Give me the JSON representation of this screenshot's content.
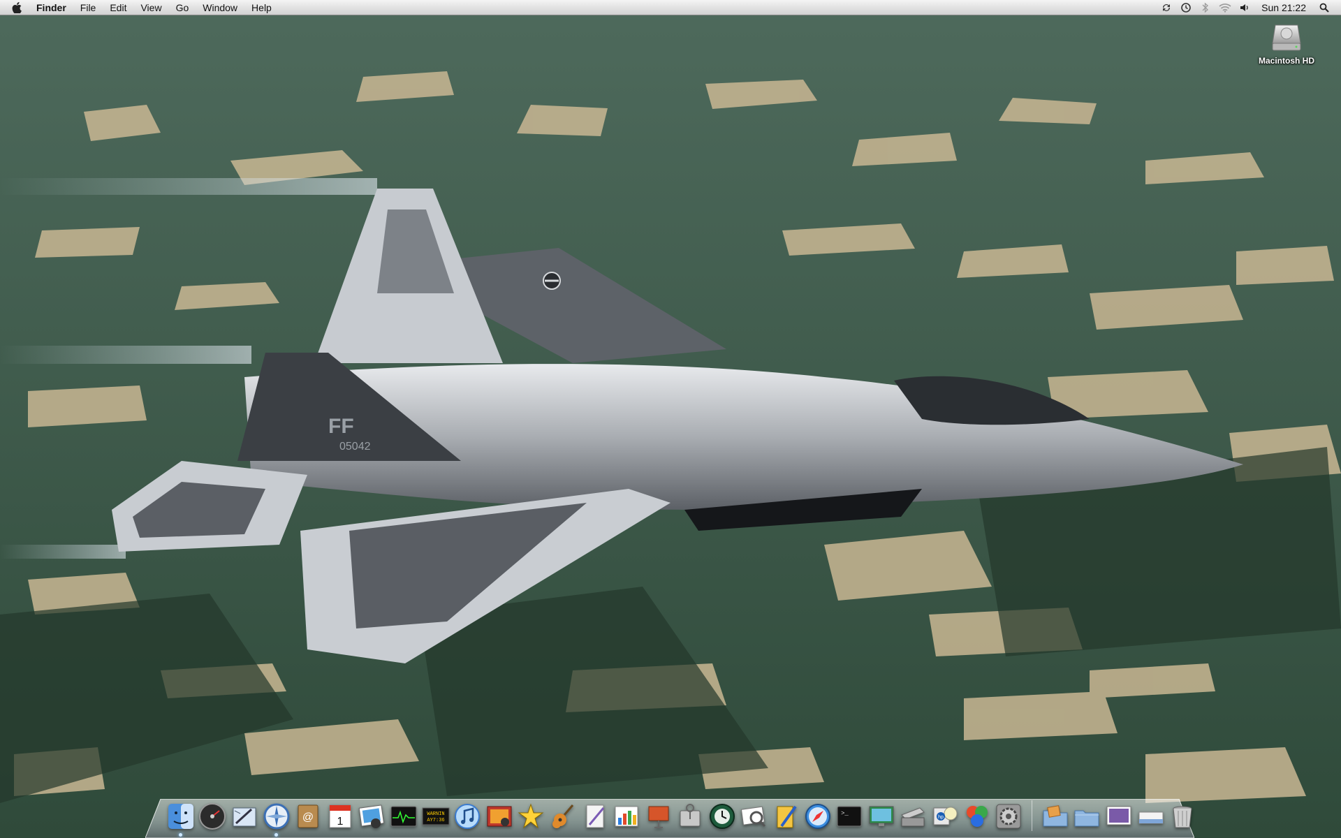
{
  "menubar": {
    "apple_icon": "apple-icon",
    "app_name": "Finder",
    "menus": [
      "File",
      "Edit",
      "View",
      "Go",
      "Window",
      "Help"
    ],
    "status_icons": [
      "sync-icon",
      "time-machine-icon",
      "bluetooth-icon",
      "wifi-icon",
      "volume-icon"
    ],
    "clock": "Sun 21:22",
    "spotlight_icon": "spotlight-icon"
  },
  "desktop": {
    "icons": [
      {
        "label": "Macintosh HD",
        "icon": "hard-drive-icon"
      }
    ],
    "wallpaper": {
      "subject": "fighter-jet-over-farmland",
      "jet_markings": [
        "FF",
        "05042"
      ]
    }
  },
  "dock": {
    "apps": [
      {
        "name": "Finder",
        "icon": "finder-icon",
        "running": true
      },
      {
        "name": "Dashboard",
        "icon": "dashboard-icon",
        "running": false
      },
      {
        "name": "Mail",
        "icon": "mail-icon",
        "running": false
      },
      {
        "name": "Safari",
        "icon": "safari-compass-icon",
        "running": true
      },
      {
        "name": "Address Book",
        "icon": "address-book-icon",
        "running": false
      },
      {
        "name": "iCal",
        "icon": "calendar-icon",
        "running": false
      },
      {
        "name": "iPhoto",
        "icon": "photos-icon",
        "running": false
      },
      {
        "name": "Activity Monitor",
        "icon": "activity-monitor-icon",
        "running": false
      },
      {
        "name": "Console",
        "icon": "console-icon",
        "running": false
      },
      {
        "name": "iTunes",
        "icon": "itunes-icon",
        "running": false
      },
      {
        "name": "Photo Booth",
        "icon": "photo-booth-icon",
        "running": false
      },
      {
        "name": "iMovie",
        "icon": "imovie-star-icon",
        "running": false
      },
      {
        "name": "GarageBand",
        "icon": "guitar-icon",
        "running": false
      },
      {
        "name": "Script Editor",
        "icon": "script-icon",
        "running": false
      },
      {
        "name": "Grapher",
        "icon": "chart-icon",
        "running": false
      },
      {
        "name": "Keynote",
        "icon": "presentation-icon",
        "running": false
      },
      {
        "name": "Disk Utility",
        "icon": "disk-utility-icon",
        "running": false
      },
      {
        "name": "Time Machine",
        "icon": "time-machine-dock-icon",
        "running": false
      },
      {
        "name": "Preview",
        "icon": "preview-icon",
        "running": false
      },
      {
        "name": "Pages",
        "icon": "pages-icon",
        "running": false
      },
      {
        "name": "Safari",
        "icon": "safari-icon",
        "running": false
      },
      {
        "name": "Terminal",
        "icon": "terminal-icon",
        "running": false
      },
      {
        "name": "Display",
        "icon": "display-icon",
        "running": false
      },
      {
        "name": "Scanner",
        "icon": "scanner-icon",
        "running": false
      },
      {
        "name": "HP Utility",
        "icon": "hp-icon",
        "running": false
      },
      {
        "name": "Currency",
        "icon": "currency-icon",
        "running": false
      },
      {
        "name": "System Preferences",
        "icon": "system-preferences-icon",
        "running": false
      }
    ],
    "stacks": [
      {
        "name": "Applications",
        "icon": "folder-stack-icon"
      },
      {
        "name": "Documents",
        "icon": "folder-icon"
      },
      {
        "name": "Screenshot",
        "icon": "screenshot-icon"
      },
      {
        "name": "Downloads",
        "icon": "downloads-icon"
      },
      {
        "name": "Trash",
        "icon": "trash-icon"
      }
    ]
  }
}
